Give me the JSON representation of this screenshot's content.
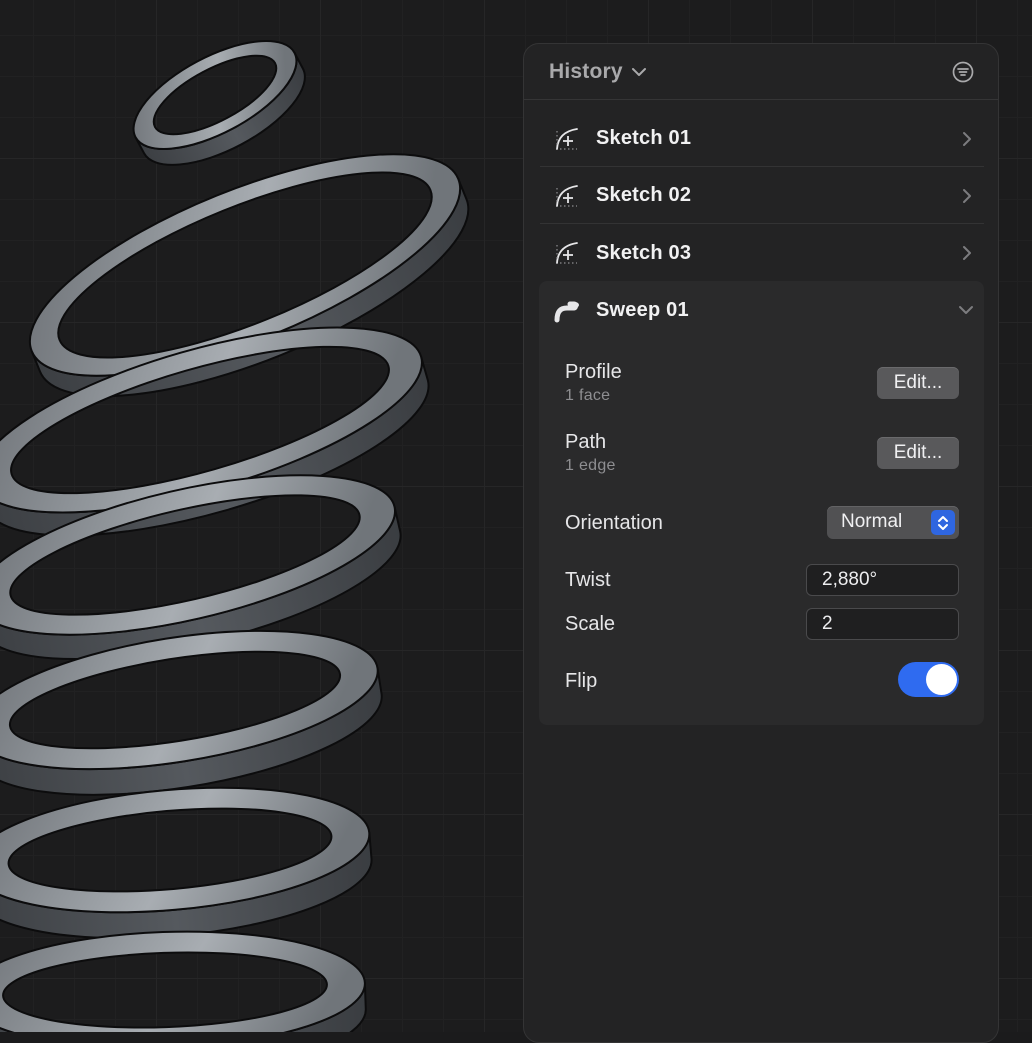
{
  "panel": {
    "title": "History",
    "chevron_icon": "chevron-down-icon",
    "filter_icon": "filter-icon"
  },
  "history": [
    {
      "label": "Sketch 01",
      "icon": "sketch-icon"
    },
    {
      "label": "Sketch 02",
      "icon": "sketch-icon"
    },
    {
      "label": "Sketch 03",
      "icon": "sketch-icon"
    }
  ],
  "sweep": {
    "label": "Sweep 01",
    "icon": "sweep-icon",
    "expanded": true,
    "profile": {
      "label": "Profile",
      "sub": "1 face",
      "button": "Edit..."
    },
    "path": {
      "label": "Path",
      "sub": "1 edge",
      "button": "Edit..."
    },
    "orientation": {
      "label": "Orientation",
      "value": "Normal"
    },
    "twist": {
      "label": "Twist",
      "value": "2,880°"
    },
    "scale": {
      "label": "Scale",
      "value": "2"
    },
    "flip": {
      "label": "Flip",
      "on": true
    }
  },
  "colors": {
    "accent": "#2f6bf0",
    "panel_bg": "#232324",
    "viewport_bg": "#1c1c1d"
  }
}
